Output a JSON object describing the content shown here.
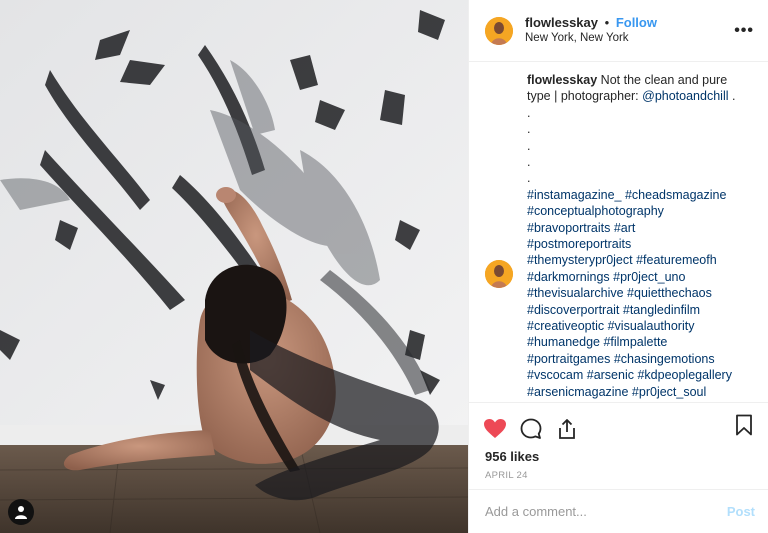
{
  "header": {
    "username": "flowlesskay",
    "separator": "•",
    "follow_label": "Follow",
    "location": "New York, New York",
    "more_label": "•••"
  },
  "caption": {
    "username": "flowlesskay",
    "text": "Not the clean and pure type | photographer: ",
    "mention": "@photoandchill",
    "text_after": " .",
    "dots": [
      ".",
      ".",
      ".",
      ".",
      "."
    ],
    "hashtags": [
      "#instamagazine_ #cheadsmagazine",
      "#conceptualphotography",
      "#bravoportraits #art",
      "#postmoreportraits",
      "#themysterypr0ject #featuremeofh",
      "#darkmornings #pr0ject_uno",
      "#thevisualarchive #quietthechaos",
      "#discoverportrait #tangledinfilm",
      "#creativeoptic #visualauthority",
      "#humanedge #filmpalette",
      "#portraitgames #chasingemotions",
      "#vscocam #arsenic #kdpeoplegallery",
      "#arsenicmagazine #pr0ject_soul"
    ]
  },
  "stats": {
    "likes": "956 likes",
    "date": "APRIL 24"
  },
  "comment_box": {
    "placeholder": "Add a comment...",
    "post_label": "Post"
  },
  "icons": {
    "like": "heart-icon",
    "comment": "comment-bubble-icon",
    "share": "share-icon",
    "save": "bookmark-icon",
    "tag": "user-tag-icon"
  },
  "colors": {
    "link": "#003569",
    "follow": "#3897f0",
    "heart": "#ed4956",
    "post_disabled": "#b2dffc"
  }
}
